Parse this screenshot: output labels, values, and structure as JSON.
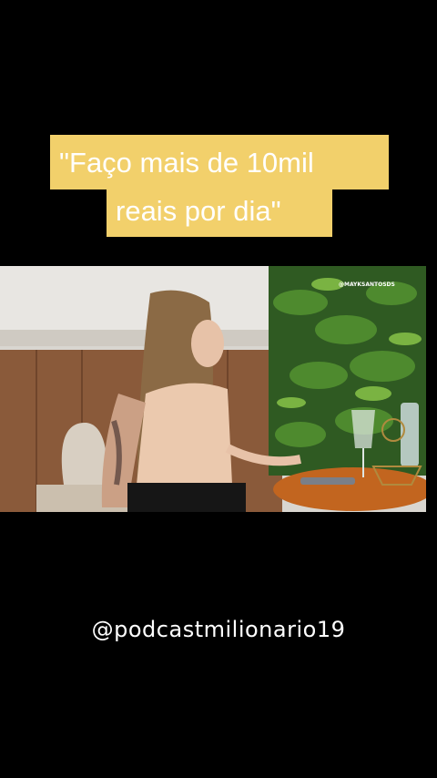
{
  "caption": {
    "line1": "\"Faço mais de 10mil",
    "line2": "reais por dia\""
  },
  "video": {
    "watermark": "@MAYKSANTOSDS"
  },
  "footer": {
    "handle": "@podcastmilionario19"
  },
  "colors": {
    "background": "#000000",
    "caption_bg": "#f2d06b",
    "caption_text": "#ffffff"
  }
}
